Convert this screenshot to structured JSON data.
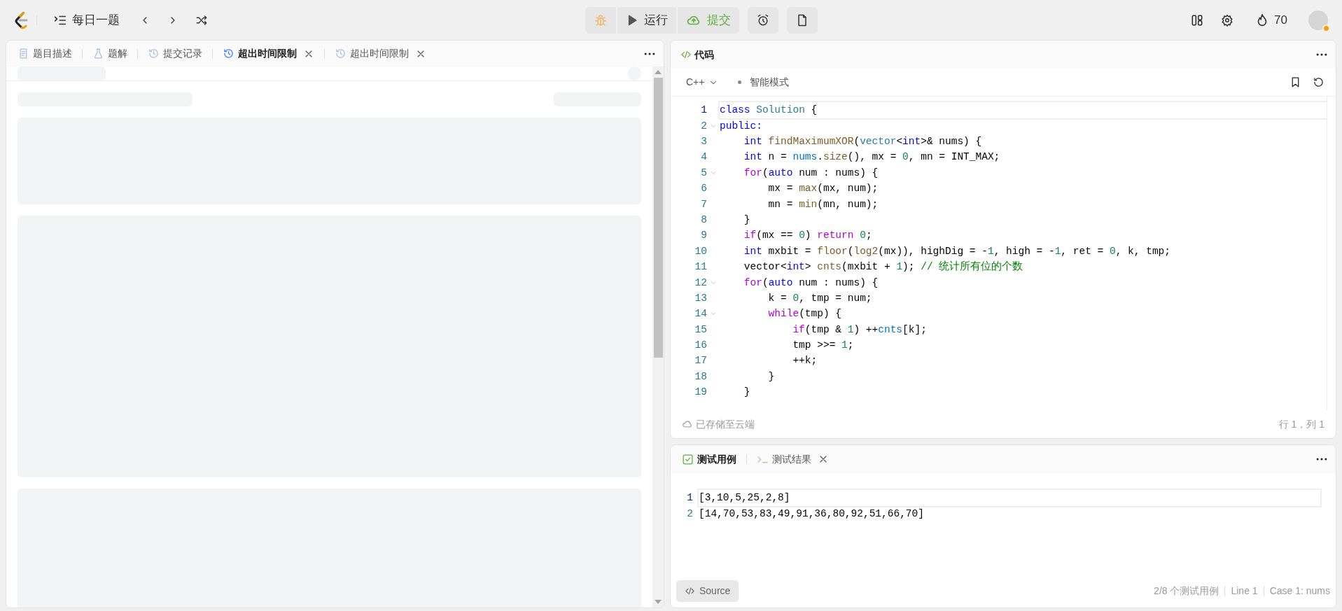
{
  "topbar": {
    "daily": "每日一题",
    "run": "运行",
    "submit": "提交",
    "streak": "70"
  },
  "left_tabs": [
    {
      "label": "题目描述",
      "kind": "doc",
      "selected": false,
      "closable": false
    },
    {
      "label": "题解",
      "kind": "flask",
      "selected": false,
      "closable": false
    },
    {
      "label": "提交记录",
      "kind": "history",
      "selected": false,
      "closable": false
    },
    {
      "label": "超出时间限制",
      "kind": "history",
      "selected": true,
      "closable": true
    },
    {
      "label": "超出时间限制",
      "kind": "history",
      "selected": false,
      "closable": true
    }
  ],
  "code_panel": {
    "title": "代码",
    "language": "C++",
    "mode": "智能模式",
    "saved": "已存储至云端",
    "cursor": "行 1，列 1",
    "lines": [
      {
        "number": "1",
        "current": true,
        "foldable": false,
        "tokens": [
          {
            "text": "class",
            "color": "#0000ff"
          },
          {
            "text": " Solution",
            "color": "#267f99"
          },
          {
            "text": " {"
          }
        ]
      },
      {
        "number": "2",
        "current": false,
        "foldable": true,
        "tokens": [
          {
            "text": "public:",
            "color": "#0000ff"
          }
        ]
      },
      {
        "number": "3",
        "current": false,
        "foldable": false,
        "tokens": [
          {
            "text": "    int",
            "color": "#0000ff"
          },
          {
            "text": " findMaximumXOR",
            "color": "#795e26"
          },
          {
            "text": "("
          },
          {
            "text": "vector",
            "color": "#267f99"
          },
          {
            "text": "<"
          },
          {
            "text": "int",
            "color": "#0000ff"
          },
          {
            "text": ">& nums) {"
          }
        ]
      },
      {
        "number": "4",
        "current": false,
        "foldable": false,
        "tokens": [
          {
            "text": "    int",
            "color": "#0000ff"
          },
          {
            "text": " n = "
          },
          {
            "text": "nums",
            "color": "#0070c1"
          },
          {
            "text": "."
          },
          {
            "text": "size",
            "color": "#795e26"
          },
          {
            "text": "(), mx = "
          },
          {
            "text": "0",
            "color": "#098658"
          },
          {
            "text": ", mn = INT_MAX;"
          }
        ]
      },
      {
        "number": "5",
        "current": false,
        "foldable": true,
        "tokens": [
          {
            "text": "    for",
            "color": "#af00db"
          },
          {
            "text": "("
          },
          {
            "text": "auto",
            "color": "#0000ff"
          },
          {
            "text": " num : nums) {"
          }
        ]
      },
      {
        "number": "6",
        "current": false,
        "foldable": false,
        "tokens": [
          {
            "text": "        mx = "
          },
          {
            "text": "max",
            "color": "#795e26"
          },
          {
            "text": "(mx, num);"
          }
        ]
      },
      {
        "number": "7",
        "current": false,
        "foldable": false,
        "tokens": [
          {
            "text": "        mn = "
          },
          {
            "text": "min",
            "color": "#795e26"
          },
          {
            "text": "(mn, num);"
          }
        ]
      },
      {
        "number": "8",
        "current": false,
        "foldable": false,
        "tokens": [
          {
            "text": "    }"
          }
        ]
      },
      {
        "number": "9",
        "current": false,
        "foldable": false,
        "tokens": [
          {
            "text": "    if",
            "color": "#af00db"
          },
          {
            "text": "(mx == "
          },
          {
            "text": "0",
            "color": "#098658"
          },
          {
            "text": ") "
          },
          {
            "text": "return",
            "color": "#af00db"
          },
          {
            "text": " 0",
            "color": "#098658"
          },
          {
            "text": ";"
          }
        ]
      },
      {
        "number": "10",
        "current": false,
        "foldable": false,
        "tokens": [
          {
            "text": "    int",
            "color": "#0000ff"
          },
          {
            "text": " mxbit = "
          },
          {
            "text": "floor",
            "color": "#795e26"
          },
          {
            "text": "("
          },
          {
            "text": "log2",
            "color": "#795e26"
          },
          {
            "text": "(mx)), highDig = -"
          },
          {
            "text": "1",
            "color": "#098658"
          },
          {
            "text": ", high = -"
          },
          {
            "text": "1",
            "color": "#098658"
          },
          {
            "text": ", ret = "
          },
          {
            "text": "0",
            "color": "#098658"
          },
          {
            "text": ", k, tmp;"
          }
        ]
      },
      {
        "number": "11",
        "current": false,
        "foldable": false,
        "tokens": [
          {
            "text": "    vector<"
          },
          {
            "text": "int",
            "color": "#0000ff"
          },
          {
            "text": "> "
          },
          {
            "text": "cnts",
            "color": "#795e26"
          },
          {
            "text": "(mxbit + "
          },
          {
            "text": "1",
            "color": "#098658"
          },
          {
            "text": "); "
          },
          {
            "text": "// 统计所有位的个数",
            "color": "#008000"
          }
        ]
      },
      {
        "number": "12",
        "current": false,
        "foldable": true,
        "tokens": [
          {
            "text": "    for",
            "color": "#af00db"
          },
          {
            "text": "("
          },
          {
            "text": "auto",
            "color": "#0000ff"
          },
          {
            "text": " num : nums) {"
          }
        ]
      },
      {
        "number": "13",
        "current": false,
        "foldable": false,
        "tokens": [
          {
            "text": "        k = "
          },
          {
            "text": "0",
            "color": "#098658"
          },
          {
            "text": ", tmp = num;"
          }
        ]
      },
      {
        "number": "14",
        "current": false,
        "foldable": true,
        "tokens": [
          {
            "text": "        while",
            "color": "#af00db"
          },
          {
            "text": "(tmp) {"
          }
        ]
      },
      {
        "number": "15",
        "current": false,
        "foldable": false,
        "tokens": [
          {
            "text": "            if",
            "color": "#af00db"
          },
          {
            "text": "(tmp & "
          },
          {
            "text": "1",
            "color": "#098658"
          },
          {
            "text": ") ++"
          },
          {
            "text": "cnts",
            "color": "#0070c1"
          },
          {
            "text": "[k];"
          }
        ]
      },
      {
        "number": "16",
        "current": false,
        "foldable": false,
        "tokens": [
          {
            "text": "            tmp >>= "
          },
          {
            "text": "1",
            "color": "#098658"
          },
          {
            "text": ";"
          }
        ]
      },
      {
        "number": "17",
        "current": false,
        "foldable": false,
        "tokens": [
          {
            "text": "            ++k;"
          }
        ]
      },
      {
        "number": "18",
        "current": false,
        "foldable": false,
        "tokens": [
          {
            "text": "        }"
          }
        ]
      },
      {
        "number": "19",
        "current": false,
        "foldable": false,
        "tokens": [
          {
            "text": "    }"
          }
        ]
      }
    ]
  },
  "test_panel": {
    "tabs": [
      {
        "label": "测试用例",
        "kind": "check",
        "selected": true,
        "closable": false
      },
      {
        "label": "测试结果",
        "kind": "terminal",
        "selected": false,
        "closable": true
      }
    ],
    "lines": [
      {
        "number": "1",
        "text": "[3,10,5,25,2,8]",
        "current": true
      },
      {
        "number": "2",
        "text": "[14,70,53,83,49,91,36,80,92,51,66,70]",
        "current": false
      }
    ],
    "source_button": "Source",
    "status": [
      "2/8 个测试用例",
      "Line 1",
      "Case 1: nums"
    ]
  }
}
